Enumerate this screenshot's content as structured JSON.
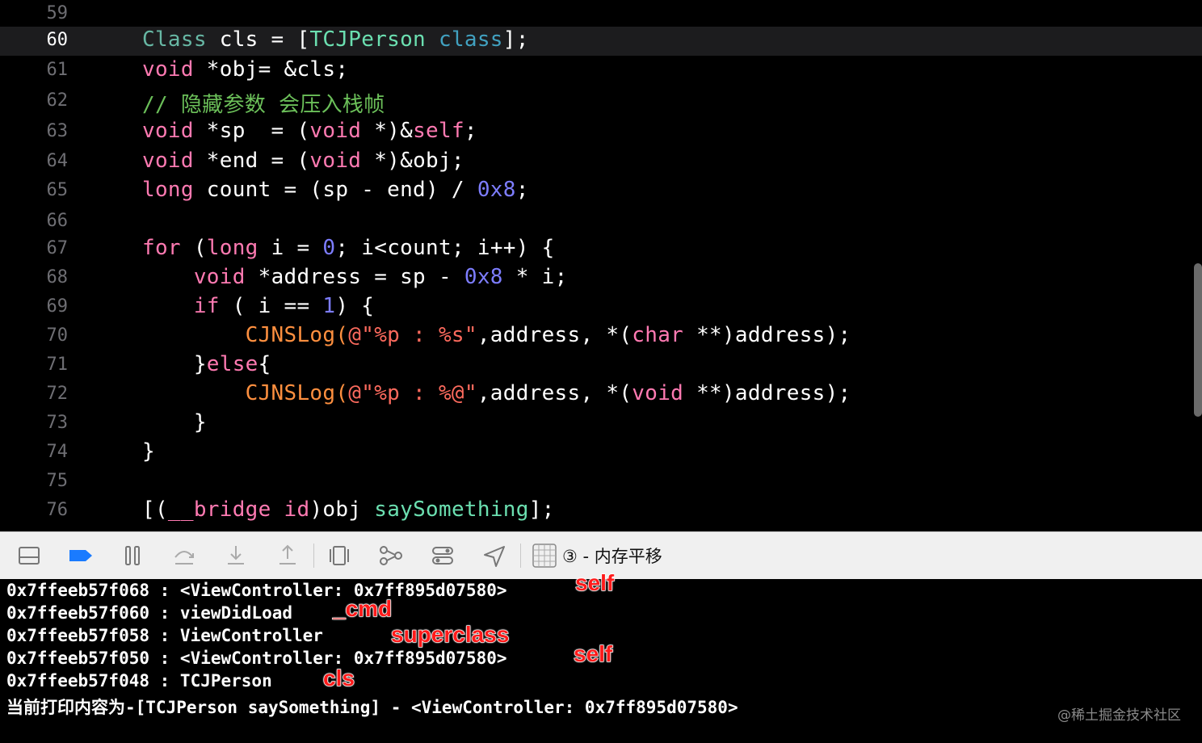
{
  "theme": {
    "keyword": "#ff7ab2",
    "comment": "#6bbf59",
    "class_type": "#67b7a4",
    "number": "#7d7dff",
    "plain": "#ffffff",
    "project_method": "#6bdfb0",
    "system_method": "#41a1c0",
    "preprocessor": "#fd8f3f",
    "string": "#fc6a5d",
    "annotation": "#ff1a1a"
  },
  "editor": {
    "current_line": 60,
    "lines": [
      {
        "n": "59",
        "segs": []
      },
      {
        "n": "60",
        "segs": [
          [
            "Class",
            "class_type"
          ],
          [
            " cls = [",
            "plain"
          ],
          [
            "TCJPerson",
            "project_method"
          ],
          [
            " ",
            "plain"
          ],
          [
            "class",
            "system_method"
          ],
          [
            "];",
            "plain"
          ]
        ]
      },
      {
        "n": "61",
        "segs": [
          [
            "void",
            "keyword"
          ],
          [
            " *obj= &cls;",
            "plain"
          ]
        ]
      },
      {
        "n": "62",
        "segs": [
          [
            "// 隐藏参数 会压入栈帧",
            "comment"
          ]
        ]
      },
      {
        "n": "63",
        "segs": [
          [
            "void",
            "keyword"
          ],
          [
            " *sp  = (",
            "plain"
          ],
          [
            "void",
            "keyword"
          ],
          [
            " *)&",
            "plain"
          ],
          [
            "self",
            "keyword"
          ],
          [
            ";",
            "plain"
          ]
        ]
      },
      {
        "n": "64",
        "segs": [
          [
            "void",
            "keyword"
          ],
          [
            " *end = (",
            "plain"
          ],
          [
            "void",
            "keyword"
          ],
          [
            " *)&obj;",
            "plain"
          ]
        ]
      },
      {
        "n": "65",
        "segs": [
          [
            "long",
            "keyword"
          ],
          [
            " count = (sp - end) / ",
            "plain"
          ],
          [
            "0x8",
            "number"
          ],
          [
            ";",
            "plain"
          ]
        ]
      },
      {
        "n": "66",
        "segs": []
      },
      {
        "n": "67",
        "segs": [
          [
            "for",
            "keyword"
          ],
          [
            " (",
            "plain"
          ],
          [
            "long",
            "keyword"
          ],
          [
            " i = ",
            "plain"
          ],
          [
            "0",
            "number"
          ],
          [
            "; i<count; i++) {",
            "plain"
          ]
        ]
      },
      {
        "n": "68",
        "segs": [
          [
            "    ",
            "plain"
          ],
          [
            "void",
            "keyword"
          ],
          [
            " *address = sp - ",
            "plain"
          ],
          [
            "0x8",
            "number"
          ],
          [
            " * i;",
            "plain"
          ]
        ]
      },
      {
        "n": "69",
        "segs": [
          [
            "    ",
            "plain"
          ],
          [
            "if",
            "keyword"
          ],
          [
            " ( i == ",
            "plain"
          ],
          [
            "1",
            "number"
          ],
          [
            ") {",
            "plain"
          ]
        ]
      },
      {
        "n": "70",
        "segs": [
          [
            "        ",
            "plain"
          ],
          [
            "CJNSLog(",
            "preprocessor"
          ],
          [
            "@\"%p : %s\"",
            "string"
          ],
          [
            ",address, *(",
            "plain"
          ],
          [
            "char",
            "keyword"
          ],
          [
            " **)address);",
            "plain"
          ]
        ]
      },
      {
        "n": "71",
        "segs": [
          [
            "    }",
            "plain"
          ],
          [
            "else",
            "keyword"
          ],
          [
            "{",
            "plain"
          ]
        ]
      },
      {
        "n": "72",
        "segs": [
          [
            "        ",
            "plain"
          ],
          [
            "CJNSLog(",
            "preprocessor"
          ],
          [
            "@\"%p : %@\"",
            "string"
          ],
          [
            ",address, *(",
            "plain"
          ],
          [
            "void",
            "keyword"
          ],
          [
            " **)address);",
            "plain"
          ]
        ]
      },
      {
        "n": "73",
        "segs": [
          [
            "    }",
            "plain"
          ]
        ]
      },
      {
        "n": "74",
        "segs": [
          [
            "}",
            "plain"
          ]
        ]
      },
      {
        "n": "75",
        "segs": []
      },
      {
        "n": "76",
        "segs": [
          [
            "[(",
            "plain"
          ],
          [
            "__bridge",
            "keyword"
          ],
          [
            " ",
            "plain"
          ],
          [
            "id",
            "keyword"
          ],
          [
            ")obj ",
            "plain"
          ],
          [
            "saySomething",
            "project_method"
          ],
          [
            "];",
            "plain"
          ]
        ]
      }
    ]
  },
  "toolbar": {
    "icons": [
      "hide-debug-area-icon",
      "breakpoints-toggle-icon",
      "pause-icon",
      "step-over-icon",
      "step-into-icon",
      "step-out-icon",
      "view-debugger-icon",
      "memory-graph-icon",
      "environment-overrides-icon",
      "simulate-location-icon"
    ],
    "target_icon": "grid-target-icon",
    "target_label": "③ - 内存平移",
    "active_color": "#1a7bff"
  },
  "console": {
    "lines": [
      "0x7ffeeb57f068 : <ViewController: 0x7ff895d07580>",
      "0x7ffeeb57f060 : viewDidLoad",
      "0x7ffeeb57f058 : ViewController",
      "0x7ffeeb57f050 : <ViewController: 0x7ff895d07580>",
      "0x7ffeeb57f048 : TCJPerson",
      "当前打印内容为-[TCJPerson saySomething] - <ViewController: 0x7ff895d07580>"
    ],
    "annotations": [
      "self",
      "_cmd",
      "superclass",
      "self",
      "cls"
    ]
  },
  "watermark": "@稀土掘金技术社区"
}
